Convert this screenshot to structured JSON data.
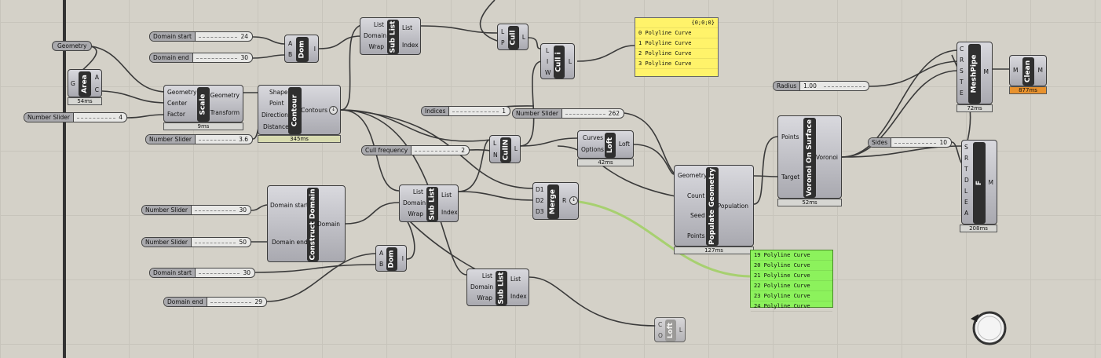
{
  "canvas": {
    "background": "#d4d1c8",
    "grid": "#c7c4bb",
    "wire": "#3a3a3a",
    "wire_selected": "#a7d070"
  },
  "params": {
    "geometry": "Geometry",
    "domain_start_1": "Domain start",
    "domain_end_1": "Domain end",
    "indices": "Indices",
    "radius": "Radius",
    "sides": "Sides",
    "domain_start_2": "Domain start",
    "domain_end_2": "Domain end"
  },
  "sliders": {
    "s_area": {
      "label": "Number Slider",
      "value": "4"
    },
    "s_dstart1": {
      "label": "Domain start",
      "value": "24"
    },
    "s_dend1": {
      "label": "Domain end",
      "value": "30"
    },
    "s_scale": {
      "label": "Number Slider",
      "value": "3.6"
    },
    "s_indices": {
      "label": "Indices",
      "value": "1"
    },
    "s_n262": {
      "label": "Number Slider",
      "value": "262"
    },
    "s_cull": {
      "label": "Cull frequency",
      "value": "2"
    },
    "s_radius": {
      "label": "Radius",
      "value": "1.00"
    },
    "s_sides": {
      "label": "Sides",
      "value": "10"
    },
    "s_30": {
      "label": "Number Slider",
      "value": "30"
    },
    "s_50": {
      "label": "Number Slider",
      "value": "50"
    },
    "s_dstart2": {
      "label": "Domain start",
      "value": "30"
    },
    "s_dend2": {
      "label": "Domain end",
      "value": "29"
    }
  },
  "components": {
    "area": {
      "name": "Area",
      "in": [
        "G"
      ],
      "out": [
        "A",
        "C"
      ],
      "timer": "54ms"
    },
    "scale": {
      "name": "Scale",
      "in": [
        "Geometry",
        "Center",
        "Factor"
      ],
      "out": [
        "Geometry",
        "Transform"
      ],
      "timer": "9ms"
    },
    "dom1": {
      "name": "Dom",
      "in": [
        "A",
        "B"
      ],
      "out": [
        "I"
      ]
    },
    "contour": {
      "name": "Contour",
      "in": [
        "Shape",
        "Point",
        "Direction",
        "Distance"
      ],
      "out": [
        "Contours"
      ],
      "timer": "345ms"
    },
    "sublist1": {
      "name": "Sub List",
      "in": [
        "List",
        "Domain",
        "Wrap"
      ],
      "out": [
        "List",
        "Index"
      ]
    },
    "cull": {
      "name": "Cull",
      "in": [
        "L",
        "P"
      ],
      "out": [
        "L"
      ]
    },
    "culli": {
      "name": "Cull i",
      "in": [
        "L",
        "I",
        "W"
      ],
      "out": [
        "L"
      ]
    },
    "culln": {
      "name": "CullN",
      "in": [
        "L",
        "N"
      ],
      "out": [
        "L"
      ]
    },
    "loft1": {
      "name": "Loft",
      "in": [
        "Curves",
        "Options"
      ],
      "out": [
        "Loft"
      ],
      "timer": "42ms"
    },
    "sublist2": {
      "name": "Sub List",
      "in": [
        "List",
        "Domain",
        "Wrap"
      ],
      "out": [
        "List",
        "Index"
      ]
    },
    "merge": {
      "name": "Merge",
      "in": [
        "D1",
        "D2",
        "D3"
      ],
      "out": [
        "R"
      ]
    },
    "construct": {
      "name": "Construct Domain",
      "in": [
        "Domain start",
        "Domain end"
      ],
      "out": [
        "Domain"
      ]
    },
    "dom2": {
      "name": "Dom",
      "in": [
        "A",
        "B"
      ],
      "out": [
        "I"
      ]
    },
    "sublist3": {
      "name": "Sub List",
      "in": [
        "List",
        "Domain",
        "Wrap"
      ],
      "out": [
        "List",
        "Index"
      ]
    },
    "populate": {
      "name": "Populate Geometry",
      "in": [
        "Geometry",
        "Count",
        "Seed",
        "Points"
      ],
      "out": [
        "Population"
      ],
      "timer": "127ms"
    },
    "voronoi": {
      "name": "Voronoi On Surface",
      "in": [
        "Points",
        "Target"
      ],
      "out": [
        "Voronoi"
      ],
      "timer": "52ms"
    },
    "meshpipe": {
      "name": "MeshPipe",
      "in": [
        "C",
        "R",
        "S",
        "T",
        "E"
      ],
      "out": [
        "M"
      ],
      "timer": "72ms"
    },
    "clean": {
      "name": "Clean",
      "in": [
        "M"
      ],
      "out": [
        "M"
      ],
      "timer": "877ms"
    },
    "f": {
      "name": "F",
      "in": [
        "S",
        "R",
        "T",
        "D",
        "L",
        "E",
        "A"
      ],
      "out": [
        "M"
      ],
      "timer": "208ms"
    },
    "loft2": {
      "name": "Loft",
      "in": [
        "C",
        "O"
      ],
      "out": [
        "L"
      ]
    }
  },
  "panel1": {
    "header": "{0;0;0}",
    "rows": [
      "0 Polyline Curve",
      "1 Polyline Curve",
      "2 Polyline Curve",
      "3 Polyline Curve"
    ]
  },
  "panel2": {
    "rows": [
      "19 Polyline Curve",
      "20 Polyline Curve",
      "21 Polyline Curve",
      "22 Polyline Curve",
      "23 Polyline Curve",
      "24 Polyline Curve"
    ]
  }
}
